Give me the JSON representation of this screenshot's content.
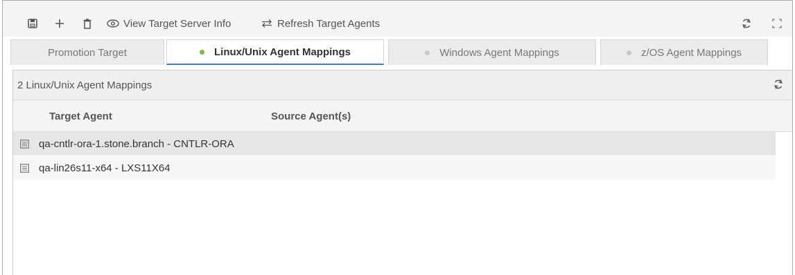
{
  "toolbar": {
    "save_icon": "save-icon",
    "add_icon": "plus-icon",
    "delete_icon": "trash-icon",
    "view_label": "View Target Server Info",
    "refresh_label": "Refresh Target Agents"
  },
  "tabs": [
    {
      "label": "Promotion Target",
      "active": false
    },
    {
      "label": "Linux/Unix Agent Mappings",
      "active": true
    },
    {
      "label": "Windows Agent Mappings",
      "active": false
    },
    {
      "label": "z/OS Agent Mappings",
      "active": false
    }
  ],
  "panel": {
    "title": "2 Linux/Unix Agent Mappings"
  },
  "grid": {
    "columns": [
      "Target Agent",
      "Source Agent(s)"
    ],
    "rows": [
      {
        "target": "qa-cntlr-ora-1.stone.branch - CNTLR-ORA",
        "source": ""
      },
      {
        "target": "qa-lin26s11-x64 - LXS11X64",
        "source": ""
      }
    ]
  },
  "colors": {
    "accent": "#3b7bbf",
    "active_dot": "#7dbb42",
    "inactive_dot": "#c9c9c9",
    "selected_row": "#e6e6e6",
    "alt_row": "#f7f7f7"
  }
}
